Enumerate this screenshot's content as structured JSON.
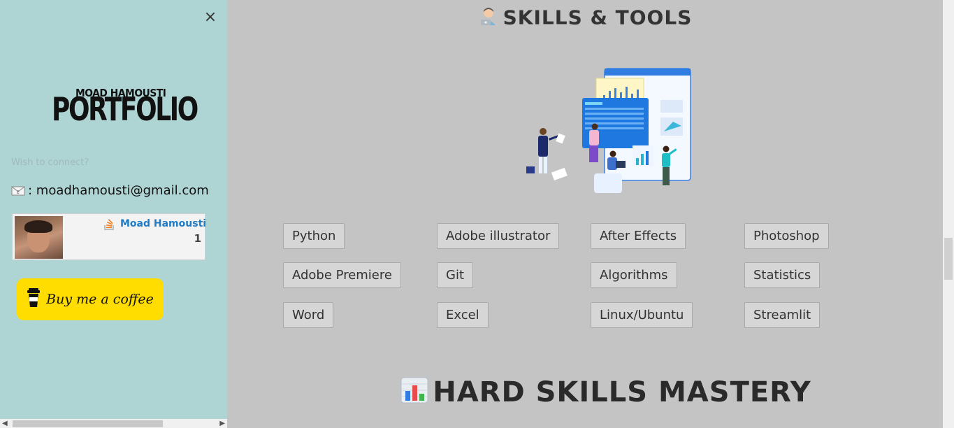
{
  "sidebar": {
    "close_glyph": "×",
    "logo": {
      "top_text": "MOAD HAMOUSTI",
      "main_text": "PORTFOLIO"
    },
    "connect_label": "Wish to connect?",
    "email_icon": "envelope-icon",
    "email_text": ": moadhamousti@gmail.com",
    "stackoverflow": {
      "name": "Moad Hamousti",
      "reputation": "1",
      "icon": "stackoverflow-icon"
    },
    "coffee_label": "Buy me a coffee"
  },
  "main": {
    "section_title": "SKILLS & TOOLS",
    "skills": [
      "Python",
      "Adobe illustrator",
      "After Effects",
      "Photoshop",
      "Adobe Premiere",
      "Git",
      "Algorithms",
      "Statistics",
      "Word",
      "Excel",
      "Linux/Ubuntu",
      "Streamlit"
    ],
    "mastery_title": "HARD SKILLS MASTERY"
  },
  "colors": {
    "sidebar_bg": "#afd4d4",
    "main_bg": "#c4c4c4",
    "coffee_yellow": "#ffdd00",
    "so_blue": "#1f7bc5"
  }
}
